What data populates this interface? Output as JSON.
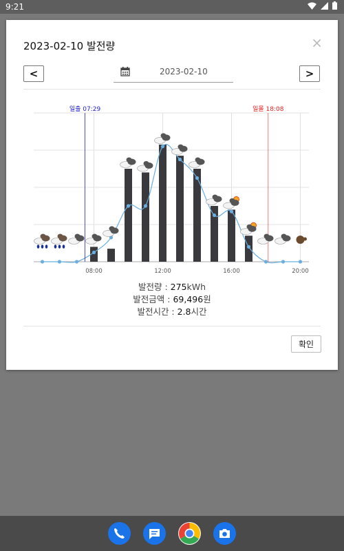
{
  "status_bar": {
    "time": "9:21"
  },
  "dialog": {
    "title": "2023-02-10 발전량",
    "close_glyph": "×",
    "prev_label": "<",
    "next_label": ">",
    "date_value": "2023-02-10",
    "confirm_label": "확인"
  },
  "summary": [
    {
      "label": "발전량 : ",
      "value": "275",
      "unit": "kWh"
    },
    {
      "label": "발전금액 : ",
      "value": "69,496",
      "unit": "원"
    },
    {
      "label": "발전시간 : ",
      "value": "2.8",
      "unit": "시간"
    }
  ],
  "chart_data": {
    "type": "bar",
    "x_ticks": [
      "08:00",
      "12:00",
      "16:00",
      "20:00"
    ],
    "x": [
      5,
      6,
      7,
      8,
      9,
      10,
      11,
      12,
      13,
      14,
      15,
      16,
      17,
      18,
      19,
      20
    ],
    "values": [
      0,
      0,
      0,
      8,
      7,
      50,
      48,
      63,
      57,
      50,
      30,
      28,
      14,
      0,
      0,
      0
    ],
    "line": [
      0,
      0,
      0,
      5,
      13,
      30,
      30,
      62,
      55,
      45,
      25,
      27,
      8,
      0,
      0,
      0
    ],
    "ylim": [
      0,
      80
    ],
    "grid": true,
    "sunrise": {
      "label": "일출 07:29",
      "x": 7.48,
      "color": "#2222cc"
    },
    "sunset": {
      "label": "일몰 18:08",
      "x": 18.13,
      "color": "#ee2222"
    },
    "weather": [
      "rain",
      "rain",
      "cloud",
      "cloud",
      "cloud",
      "cloud",
      "cloud",
      "cloud",
      "cloud",
      "cloud",
      "cloud",
      "partly-sunny",
      "partly-sunny",
      "cloud",
      "cloud",
      "dark-cloud"
    ],
    "colors": {
      "bar": "#3a3a3e",
      "line": "#6aaee0",
      "grid": "#e0e0e0"
    }
  },
  "dock": [
    {
      "name": "phone-app-icon",
      "color": "#1a73e8"
    },
    {
      "name": "messages-app-icon",
      "color": "#1a73e8"
    },
    {
      "name": "chrome-app-icon",
      "color": "#ffffff"
    },
    {
      "name": "camera-app-icon",
      "color": "#1a73e8"
    }
  ]
}
